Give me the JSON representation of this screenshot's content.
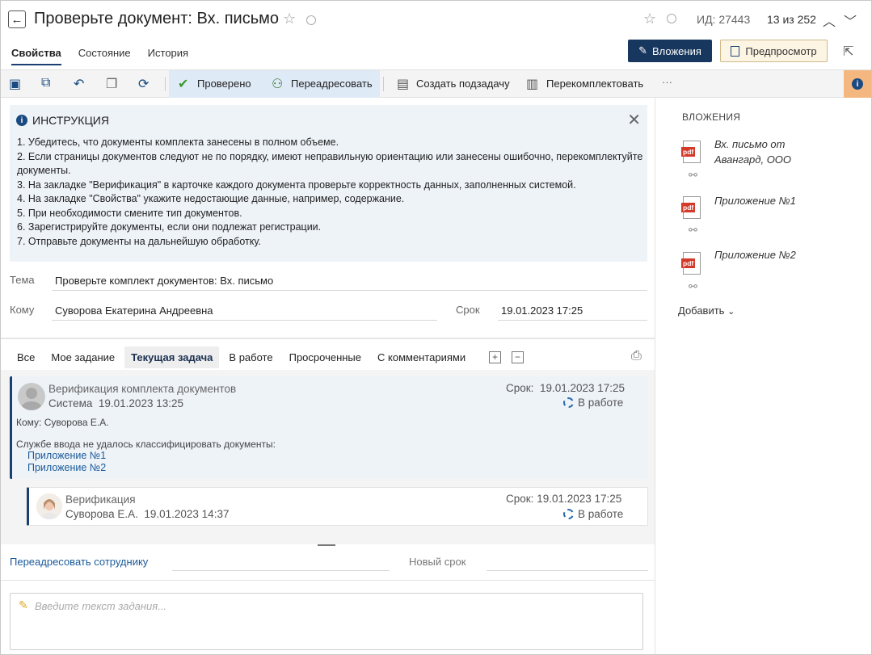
{
  "header": {
    "title": "Проверьте документ: Вх. письмо",
    "id_text": "ИД: 27443",
    "count_text": "13 из 252"
  },
  "tabs": [
    {
      "label": "Свойства",
      "active": true
    },
    {
      "label": "Состояние",
      "active": false
    },
    {
      "label": "История",
      "active": false
    }
  ],
  "buttons": {
    "attachments": "Вложения",
    "preview": "Предпросмотр"
  },
  "toolbar": {
    "checked": "Проверено",
    "redirect": "Переадресовать",
    "create_subtask": "Создать подзадачу",
    "recomplete": "Перекомплектовать",
    "more": "···"
  },
  "instruction": {
    "title": "ИНСТРУКЦИЯ",
    "lines": [
      "1. Убедитесь, что документы комплекта занесены в полном объеме.",
      "2. Если страницы документов следуют не по порядку, имеют неправильную ориентацию или занесены ошибочно, перекомплектуйте документы.",
      "3. На закладке \"Верификация\" в карточке каждого документа проверьте корректность данных, заполненных системой.",
      "4. На закладке \"Свойства\" укажите недостающие данные, например, содержание.",
      "5. При необходимости смените тип документов.",
      "6. Зарегистрируйте документы, если они подлежат регистрации.",
      "7. Отправьте документы на дальнейшую обработку."
    ]
  },
  "form": {
    "subject_label": "Тема",
    "subject_value": "Проверьте комплект документов: Вх. письмо",
    "to_label": "Кому",
    "to_value": "Суворова Екатерина Андреевна",
    "due_label": "Срок",
    "due_value": "19.01.2023 17:25"
  },
  "filters": [
    {
      "label": "Все",
      "active": false
    },
    {
      "label": "Мое задание",
      "active": false
    },
    {
      "label": "Текущая задача",
      "active": true
    },
    {
      "label": "В работе",
      "active": false
    },
    {
      "label": "Просроченные",
      "active": false
    },
    {
      "label": "С комментариями",
      "active": false
    }
  ],
  "tasks": [
    {
      "title": "Верификация комплекта документов",
      "author": "Система",
      "date": "19.01.2023 13:25",
      "due_label": "Срок:",
      "due": "19.01.2023 17:25",
      "status": "В работе",
      "to": "Кому: Суворова Е.А.",
      "message": "Службе ввода не удалось классифицировать документы:",
      "links": [
        "Приложение №1",
        "Приложение №2"
      ]
    },
    {
      "title": "Верификация",
      "author": "Суворова Е.А.",
      "date": "19.01.2023 14:37",
      "due_label": "Срок:",
      "due": "19.01.2023 17:25",
      "status": "В работе"
    }
  ],
  "bottom": {
    "redirect_label": "Переадресовать сотруднику",
    "new_due_label": "Новый срок",
    "textarea_placeholder": "Введите текст задания..."
  },
  "attachments_panel": {
    "title": "ВЛОЖЕНИЯ",
    "items": [
      {
        "name": "Вх. письмо от Авангард, ООО",
        "badge": "pdf"
      },
      {
        "name": "Приложение №1",
        "badge": "pdf"
      },
      {
        "name": "Приложение №2",
        "badge": "pdf"
      }
    ],
    "add_label": "Добавить"
  },
  "colors": {
    "primary": "#17375e",
    "accent_info": "#f5b780",
    "highlight": "#dfeaf7",
    "pdf_badge": "#d43a2a",
    "link": "#1a5a9a"
  }
}
